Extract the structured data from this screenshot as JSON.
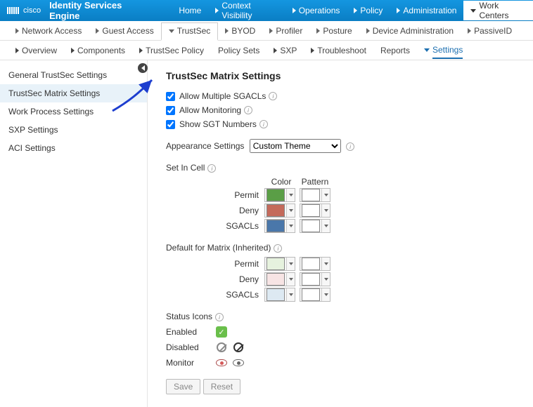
{
  "header": {
    "vendor": "cisco",
    "app_title": "Identity Services Engine",
    "nav": [
      "Home",
      "Context Visibility",
      "Operations",
      "Policy",
      "Administration",
      "Work Centers"
    ],
    "nav_active": 5
  },
  "subnav1": {
    "items": [
      "Network Access",
      "Guest Access",
      "TrustSec",
      "BYOD",
      "Profiler",
      "Posture",
      "Device Administration",
      "PassiveID"
    ],
    "active": 2
  },
  "subnav2": {
    "items": [
      "Overview",
      "Components",
      "TrustSec Policy",
      "Policy Sets",
      "SXP",
      "Troubleshoot",
      "Reports",
      "Settings"
    ],
    "caret": [
      true,
      true,
      true,
      false,
      true,
      true,
      false,
      true
    ],
    "active": 7
  },
  "sidebar": {
    "items": [
      "General TrustSec Settings",
      "TrustSec Matrix Settings",
      "Work Process Settings",
      "SXP Settings",
      "ACI Settings"
    ],
    "active": 1
  },
  "page": {
    "title": "TrustSec Matrix Settings",
    "checkboxes": {
      "allow_multiple": {
        "label": "Allow Multiple SGACLs",
        "checked": true
      },
      "allow_monitoring": {
        "label": "Allow Monitoring",
        "checked": true
      },
      "show_sgt": {
        "label": "Show SGT Numbers",
        "checked": true
      }
    },
    "appearance": {
      "label": "Appearance Settings",
      "value": "Custom Theme"
    },
    "set_in_cell": {
      "label": "Set In Cell",
      "col_color": "Color",
      "col_pattern": "Pattern",
      "rows": [
        {
          "label": "Permit",
          "color": "#5a9e46"
        },
        {
          "label": "Deny",
          "color": "#c46a5b"
        },
        {
          "label": "SGACLs",
          "color": "#4a77aa"
        }
      ]
    },
    "default_matrix": {
      "label": "Default for Matrix (Inherited)",
      "rows": [
        {
          "label": "Permit",
          "color": "#e6f2de"
        },
        {
          "label": "Deny",
          "color": "#f7e4e4"
        },
        {
          "label": "SGACLs",
          "color": "#dde9f2"
        }
      ]
    },
    "status_icons": {
      "label": "Status Icons",
      "rows": [
        "Enabled",
        "Disabled",
        "Monitor"
      ]
    },
    "buttons": {
      "save": "Save",
      "reset": "Reset"
    }
  }
}
